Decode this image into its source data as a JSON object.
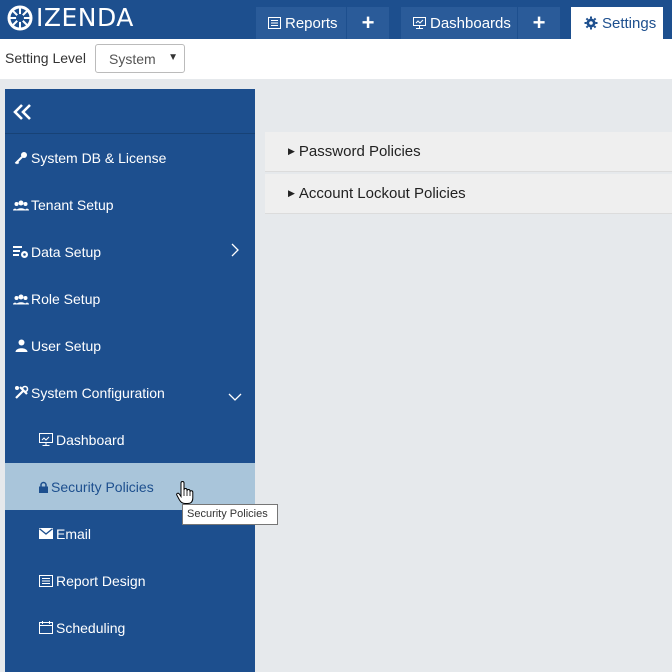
{
  "brand": {
    "name": "IZENDA"
  },
  "tabs": {
    "reports_label": "Reports",
    "dashboards_label": "Dashboards",
    "settings_label": "Settings"
  },
  "setting_level": {
    "label": "Setting Level",
    "value": "System"
  },
  "sidebar": {
    "items": [
      {
        "label": "System DB & License",
        "icon": "key-icon"
      },
      {
        "label": "Tenant Setup",
        "icon": "users-icon"
      },
      {
        "label": "Data Setup",
        "icon": "data-setup-icon"
      },
      {
        "label": "Role Setup",
        "icon": "users-icon"
      },
      {
        "label": "User Setup",
        "icon": "user-icon"
      },
      {
        "label": "System Configuration",
        "icon": "wrench-icon"
      },
      {
        "label": "Dashboard",
        "icon": "dashboard-icon"
      },
      {
        "label": "Security Policies",
        "icon": "lock-icon"
      },
      {
        "label": "Email",
        "icon": "envelope-icon"
      },
      {
        "label": "Report Design",
        "icon": "report-icon"
      },
      {
        "label": "Scheduling",
        "icon": "calendar-icon"
      }
    ]
  },
  "panels": [
    {
      "label": "Password Policies"
    },
    {
      "label": "Account Lockout Policies"
    }
  ],
  "tooltip": {
    "text": "Security Policies"
  },
  "colors": {
    "primary": "#1d4f8e",
    "active_item": "#a9c5da",
    "content_bg": "#e6e9ec"
  }
}
